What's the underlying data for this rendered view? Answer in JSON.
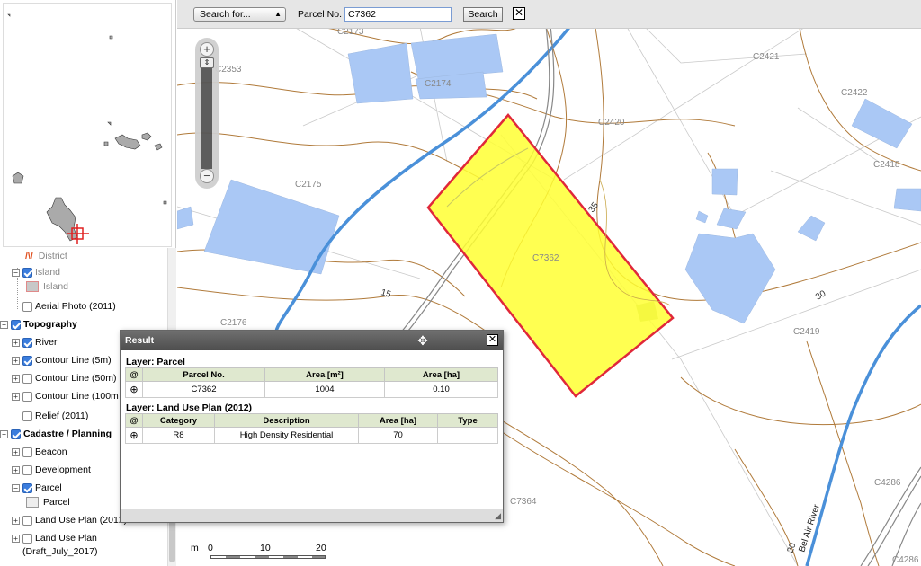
{
  "toolbar": {
    "search_select": "Search for...",
    "parcel_label": "Parcel No.",
    "parcel_value": "C7362",
    "search_button": "Search",
    "clear_button": "✕"
  },
  "layer_tree": {
    "district_label": "District",
    "island_group": "Island",
    "island_legend": "Island",
    "aerial_photo": "Aerial Photo (2011)",
    "topography": "Topography",
    "river": "River",
    "contour_5m": "Contour Line (5m)",
    "contour_50m": "Contour Line (50m)",
    "contour_100m": "Contour Line (100m",
    "relief": "Relief (2011)",
    "cadastre": "Cadastre / Planning",
    "beacon": "Beacon",
    "development": "Development",
    "parcel": "Parcel",
    "parcel_legend": "Parcel",
    "land_use_2012": "Land Use Plan (2012)",
    "land_use_draft_1": "Land Use Plan",
    "land_use_draft_2": "(Draft_July_2017)"
  },
  "map_labels": {
    "parcels": [
      "C2173",
      "C2174",
      "C2353",
      "C2175",
      "C2420",
      "C2421",
      "C2422",
      "C2418",
      "C7362",
      "C2176",
      "C2419",
      "C7364",
      "C4286",
      "C4286"
    ],
    "contours": [
      "35",
      "15",
      "30",
      "20"
    ],
    "river_name": "Bel Air River"
  },
  "scale_bar": {
    "unit": "m",
    "ticks": [
      "0",
      "10",
      "20"
    ]
  },
  "result_popup": {
    "title": "Result",
    "layer1_title": "Layer: Parcel",
    "layer1_headers": [
      "@",
      "Parcel No.",
      "Area [m²]",
      "Area [ha]"
    ],
    "layer1_row": [
      "C7362",
      "1004",
      "0.10"
    ],
    "layer2_title": "Layer: Land Use Plan (2012)",
    "layer2_headers": [
      "@",
      "Category",
      "Description",
      "Area [ha]",
      "Type"
    ],
    "layer2_row": [
      "R8",
      "High Density Residential",
      "70",
      ""
    ]
  },
  "colors": {
    "parcel_fill": "#ffff33",
    "parcel_outline": "#e0283a",
    "building_fill": "#aac8f5",
    "river": "#4a90d9",
    "contour": "#b07a3a",
    "road": "#888888"
  },
  "icons": {
    "zoom_in": "plus-icon",
    "zoom_out": "minus-icon",
    "move": "move-icon",
    "close": "close-icon",
    "zoom_to": "zoom-to-icon"
  }
}
